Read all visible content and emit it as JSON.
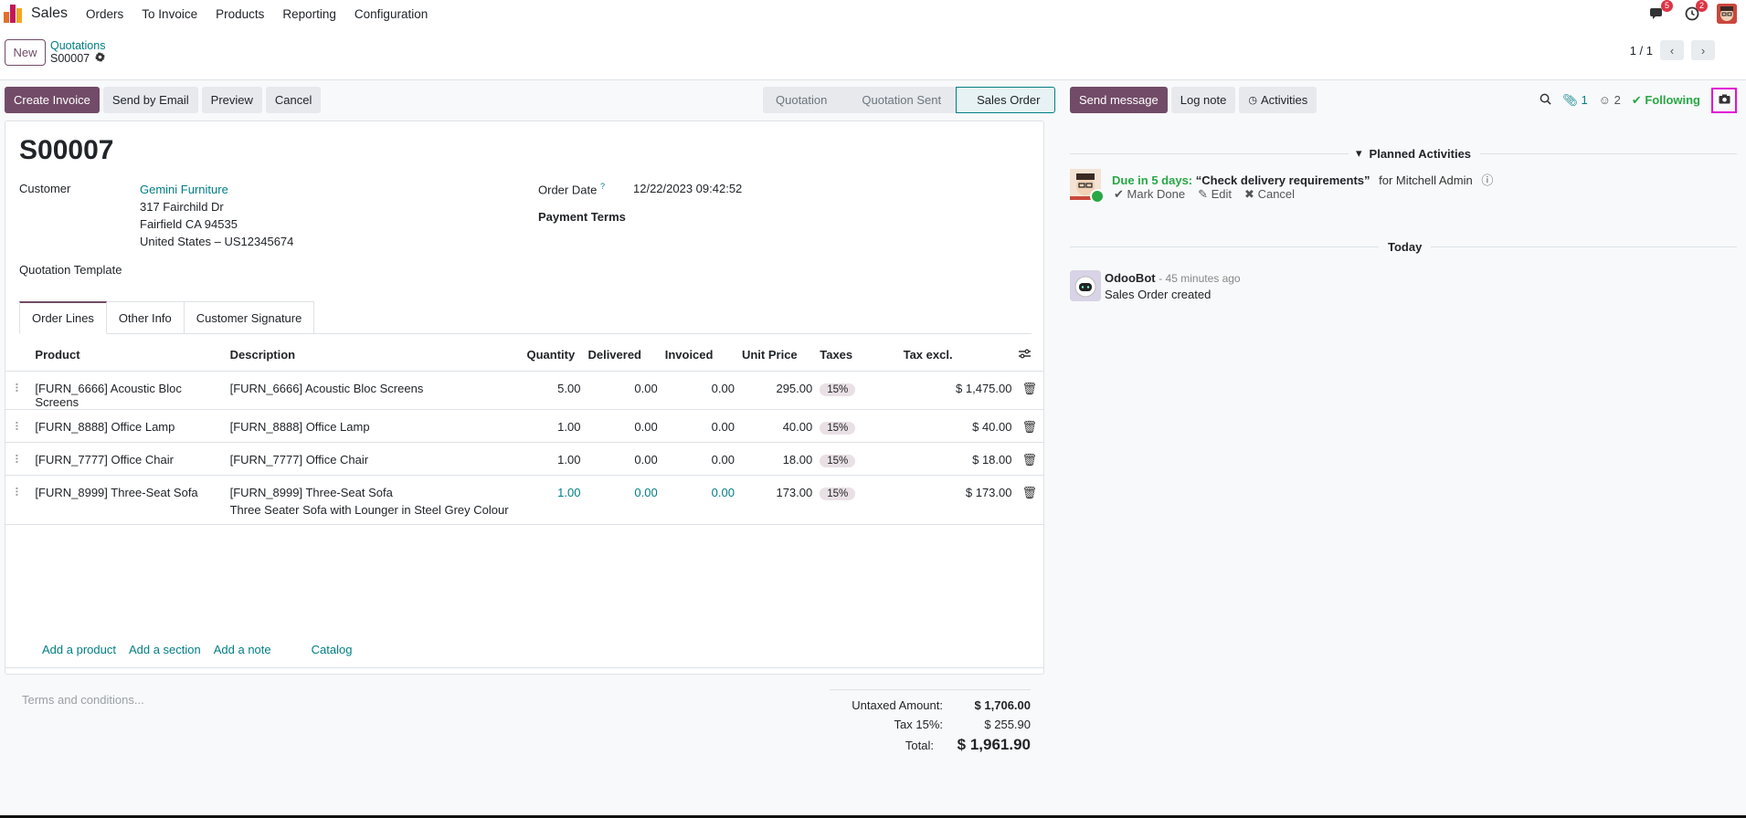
{
  "topbar": {
    "app_name": "Sales",
    "menu": [
      "Orders",
      "To Invoice",
      "Products",
      "Reporting",
      "Configuration"
    ],
    "messages_badge": "5",
    "activities_badge": "2",
    "icons": [
      "odoo-logo-icon",
      "chat-icon",
      "clock-icon",
      "avatar"
    ]
  },
  "control_panel": {
    "new_label": "New",
    "breadcrumb_parent": "Quotations",
    "breadcrumb_current": "S00007",
    "pager": "1 / 1"
  },
  "actions": {
    "create_invoice": "Create Invoice",
    "send_by_email": "Send by Email",
    "preview": "Preview",
    "cancel": "Cancel"
  },
  "status": {
    "stages": [
      "Quotation",
      "Quotation Sent",
      "Sales Order"
    ],
    "active": "Sales Order"
  },
  "form": {
    "name": "S00007",
    "customer_label": "Customer",
    "customer_name": "Gemini Furniture",
    "address_line1": "317 Fairchild Dr",
    "address_line2": "Fairfield CA 94535",
    "address_line3": "United States – US12345674",
    "quotation_template_label": "Quotation Template",
    "order_date_label": "Order Date",
    "order_date_help": "?",
    "order_date_value": "12/22/2023 09:42:52",
    "payment_terms_label": "Payment Terms"
  },
  "tabs": [
    "Order Lines",
    "Other Info",
    "Customer Signature"
  ],
  "lines": {
    "headers": {
      "product": "Product",
      "description": "Description",
      "quantity": "Quantity",
      "delivered": "Delivered",
      "invoiced": "Invoiced",
      "unit_price": "Unit Price",
      "taxes": "Taxes",
      "tax_excl": "Tax excl."
    },
    "rows": [
      {
        "product": "[FURN_6666] Acoustic Bloc Screens",
        "description": "[FURN_6666] Acoustic Bloc Screens",
        "description2": "",
        "quantity": "5.00",
        "delivered": "0.00",
        "invoiced": "0.00",
        "unit_price": "295.00",
        "tax": "15%",
        "subtotal": "$ 1,475.00"
      },
      {
        "product": "[FURN_8888] Office Lamp",
        "description": "[FURN_8888] Office Lamp",
        "description2": "",
        "quantity": "1.00",
        "delivered": "0.00",
        "invoiced": "0.00",
        "unit_price": "40.00",
        "tax": "15%",
        "subtotal": "$ 40.00"
      },
      {
        "product": "[FURN_7777] Office Chair",
        "description": "[FURN_7777] Office Chair",
        "description2": "",
        "quantity": "1.00",
        "delivered": "0.00",
        "invoiced": "0.00",
        "unit_price": "18.00",
        "tax": "15%",
        "subtotal": "$ 18.00"
      },
      {
        "product": "[FURN_8999] Three-Seat Sofa",
        "description": "[FURN_8999] Three-Seat Sofa",
        "description2": "Three Seater Sofa with Lounger in Steel Grey Colour",
        "quantity": "1.00",
        "delivered": "0.00",
        "invoiced": "0.00",
        "unit_price": "173.00",
        "tax": "15%",
        "subtotal": "$ 173.00"
      }
    ],
    "add_product": "Add a product",
    "add_section": "Add a section",
    "add_note": "Add a note",
    "catalog": "Catalog"
  },
  "terms_placeholder": "Terms and conditions...",
  "totals": {
    "untaxed_label": "Untaxed Amount:",
    "untaxed_value": "$ 1,706.00",
    "tax_label": "Tax 15%:",
    "tax_value": "$ 255.90",
    "total_label": "Total:",
    "total_value": "$ 1,961.90"
  },
  "chatter": {
    "send_message": "Send message",
    "log_note": "Log note",
    "activities": "Activities",
    "attachments_count": "1",
    "followers_count": "2",
    "following": "Following",
    "planned_activities": "Planned Activities",
    "activity_due": "Due in 5 days:",
    "activity_summary": "“Check delivery requirements”",
    "activity_for": "for Mitchell Admin",
    "mark_done": "Mark Done",
    "edit": "Edit",
    "cancel": "Cancel",
    "today": "Today",
    "message_author": "OdooBot",
    "message_time": "- 45 minutes ago",
    "message_body": "Sales Order created"
  },
  "colors": {
    "primary": "#714b67",
    "link": "#017e84",
    "success": "#28a745",
    "badge": "#dc3545",
    "highlight": "#e20fd4"
  }
}
